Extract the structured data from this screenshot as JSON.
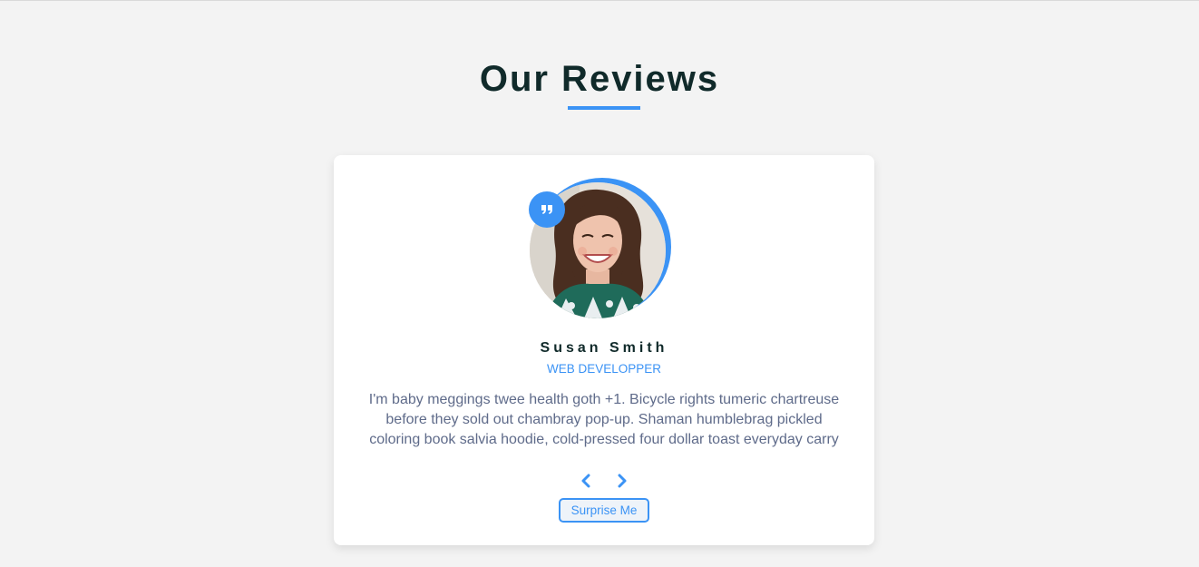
{
  "page": {
    "title": "Our Reviews"
  },
  "review": {
    "name": "Susan Smith",
    "job": "WEB DEVELOPPER",
    "text": "I'm baby meggings twee health goth +1. Bicycle rights tumeric chartreuse before they sold out chambray pop-up. Shaman humblebrag pickled coloring book salvia hoodie, cold-pressed four dollar toast everyday carry",
    "photo_icon": "person-photo",
    "quote_icon": "quote-icon"
  },
  "controls": {
    "prev_icon": "chevron-left-icon",
    "next_icon": "chevron-right-icon",
    "surprise_label": "Surprise Me"
  },
  "colors": {
    "accent": "#3b93f5",
    "background": "#f3f3f3",
    "title": "#102a2a",
    "body_text": "#5f6b8a",
    "card": "#ffffff"
  }
}
